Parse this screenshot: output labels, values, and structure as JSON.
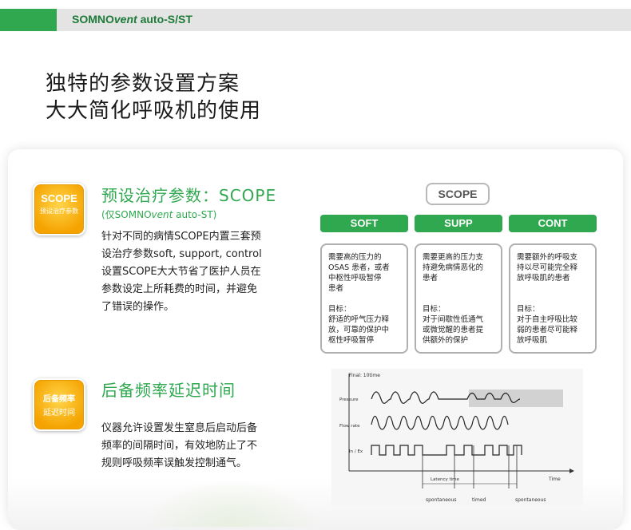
{
  "header": {
    "brand_prefix": "SOMNO",
    "brand_italic": "vent",
    "brand_suffix": " auto-S/ST",
    "accent_color": "#2fa84f"
  },
  "headline": {
    "line1": "独特的参数设置方案",
    "line2": "大大简化呼吸机的使用"
  },
  "section1": {
    "badge_title": "SCOPE",
    "badge_sub": "预设治疗参数",
    "title": "预设治疗参数：SCOPE",
    "sub_prefix": "(仅SOMNO",
    "sub_italic": "vent",
    "sub_suffix": " auto-ST)",
    "body_lines": [
      "针对不同的病情SCOPE内置三套预",
      "设治疗参数soft, support, control",
      "设置SCOPE大大节省了医护人员在",
      "参数设定上所耗费的时间，并避免",
      "了错误的操作。"
    ]
  },
  "scope_diagram": {
    "label": "SCOPE",
    "modes": [
      {
        "name": "SOFT",
        "desc": [
          "需要高的压力的",
          "OSAS 患者，或者",
          "中枢性呼吸暂停",
          "患者"
        ],
        "goal_label": "目标：",
        "goal": [
          "舒适的呼气压力释",
          "放，可靠的保护中",
          "枢性呼吸暂停"
        ]
      },
      {
        "name": "SUPP",
        "desc": [
          "需要更高的压力支",
          "持避免病情恶化的",
          "患者"
        ],
        "goal_label": "目标：",
        "goal": [
          "对于间歇性低通气",
          "或微觉醒的患者提",
          "供额外的保护"
        ]
      },
      {
        "name": "CONT",
        "desc": [
          "需要额外的呼吸支",
          "持以尽可能完全释",
          "放呼吸肌的患者"
        ],
        "goal_label": "目标：",
        "goal": [
          "对于自主呼吸比较",
          "弱的患者尽可能释",
          "放呼吸肌"
        ]
      }
    ]
  },
  "section2": {
    "badge_line1": "后备频率",
    "badge_line2": "延迟时间",
    "title": "后备频率延迟时间",
    "body_lines": [
      "仪器允许设置发生窒息后启动后备",
      "频率的间隔时间，有效地防止了不",
      "规则呼吸频率误触发控制通气。"
    ]
  },
  "waveform": {
    "top_label": "Final: 10time",
    "row_labels": [
      "Pressure",
      "Flow rate",
      "In / Ex"
    ],
    "time_label": "Time",
    "latency_label": "Latency time",
    "bottom_labels": [
      "spontaneous",
      "timed",
      "spontaneous"
    ]
  }
}
